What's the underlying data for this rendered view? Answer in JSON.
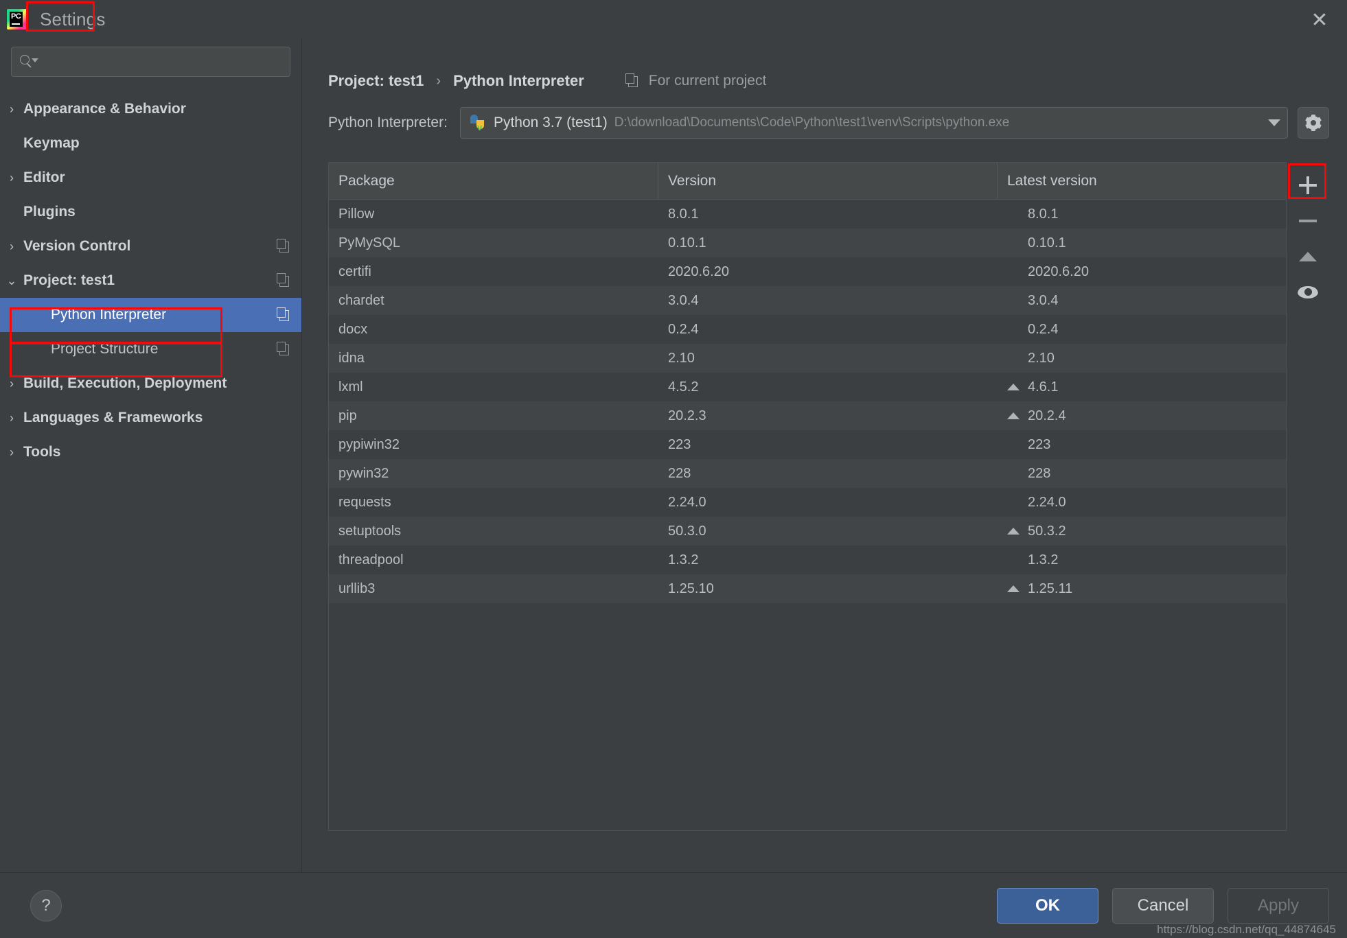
{
  "window": {
    "title": "Settings",
    "logo_icon": "pycharm-logo",
    "close_icon": "close-icon"
  },
  "search": {
    "value": "",
    "placeholder": "",
    "icon": "search-icon"
  },
  "sidebar": {
    "items": [
      {
        "label": "Appearance & Behavior",
        "chevron": "›",
        "group": true,
        "indent": false,
        "selected": false,
        "copy": false
      },
      {
        "label": "Keymap",
        "chevron": "",
        "group": true,
        "indent": false,
        "selected": false,
        "copy": false
      },
      {
        "label": "Editor",
        "chevron": "›",
        "group": true,
        "indent": false,
        "selected": false,
        "copy": false
      },
      {
        "label": "Plugins",
        "chevron": "",
        "group": true,
        "indent": false,
        "selected": false,
        "copy": false
      },
      {
        "label": "Version Control",
        "chevron": "›",
        "group": true,
        "indent": false,
        "selected": false,
        "copy": true
      },
      {
        "label": "Project: test1",
        "chevron": "⌄",
        "group": true,
        "indent": false,
        "selected": false,
        "copy": true
      },
      {
        "label": "Python Interpreter",
        "chevron": "",
        "group": false,
        "indent": true,
        "selected": true,
        "copy": true
      },
      {
        "label": "Project Structure",
        "chevron": "",
        "group": false,
        "indent": true,
        "selected": false,
        "copy": true
      },
      {
        "label": "Build, Execution, Deployment",
        "chevron": "›",
        "group": true,
        "indent": false,
        "selected": false,
        "copy": false
      },
      {
        "label": "Languages & Frameworks",
        "chevron": "›",
        "group": true,
        "indent": false,
        "selected": false,
        "copy": false
      },
      {
        "label": "Tools",
        "chevron": "›",
        "group": true,
        "indent": false,
        "selected": false,
        "copy": false
      }
    ]
  },
  "breadcrumb": {
    "parent": "Project: test1",
    "separator": "›",
    "current": "Python Interpreter",
    "scope_label": "For current project",
    "scope_icon": "copy-icon"
  },
  "interpreter": {
    "label": "Python Interpreter:",
    "icon": "python-venv-icon",
    "name": "Python 3.7 (test1)",
    "path": "D:\\download\\Documents\\Code\\Python\\test1\\venv\\Scripts\\python.exe",
    "dropdown_icon": "chevron-down-icon",
    "gear_icon": "gear-icon"
  },
  "packages_table": {
    "columns": [
      "Package",
      "Version",
      "Latest version"
    ],
    "rows": [
      {
        "package": "Pillow",
        "version": "8.0.1",
        "latest": "8.0.1",
        "upgradable": false
      },
      {
        "package": "PyMySQL",
        "version": "0.10.1",
        "latest": "0.10.1",
        "upgradable": false
      },
      {
        "package": "certifi",
        "version": "2020.6.20",
        "latest": "2020.6.20",
        "upgradable": false
      },
      {
        "package": "chardet",
        "version": "3.0.4",
        "latest": "3.0.4",
        "upgradable": false
      },
      {
        "package": "docx",
        "version": "0.2.4",
        "latest": "0.2.4",
        "upgradable": false
      },
      {
        "package": "idna",
        "version": "2.10",
        "latest": "2.10",
        "upgradable": false
      },
      {
        "package": "lxml",
        "version": "4.5.2",
        "latest": "4.6.1",
        "upgradable": true
      },
      {
        "package": "pip",
        "version": "20.2.3",
        "latest": "20.2.4",
        "upgradable": true
      },
      {
        "package": "pypiwin32",
        "version": "223",
        "latest": "223",
        "upgradable": false
      },
      {
        "package": "pywin32",
        "version": "228",
        "latest": "228",
        "upgradable": false
      },
      {
        "package": "requests",
        "version": "2.24.0",
        "latest": "2.24.0",
        "upgradable": false
      },
      {
        "package": "setuptools",
        "version": "50.3.0",
        "latest": "50.3.2",
        "upgradable": true
      },
      {
        "package": "threadpool",
        "version": "1.3.2",
        "latest": "1.3.2",
        "upgradable": false
      },
      {
        "package": "urllib3",
        "version": "1.25.10",
        "latest": "1.25.11",
        "upgradable": true
      }
    ]
  },
  "toolbar": {
    "add_icon": "plus-icon",
    "remove_icon": "minus-icon",
    "upgrade_icon": "up-arrow-icon",
    "show_early_icon": "eye-icon"
  },
  "footer": {
    "help_label": "?",
    "ok_label": "OK",
    "cancel_label": "Cancel",
    "apply_label": "Apply",
    "watermark": "https://blog.csdn.net/qq_44874645"
  },
  "colors": {
    "background": "#3C3F41",
    "row_alt": "#414547",
    "selection": "#4A6FB5",
    "primary_button": "#3C6199",
    "highlight_annotation": "#F30B0B"
  }
}
